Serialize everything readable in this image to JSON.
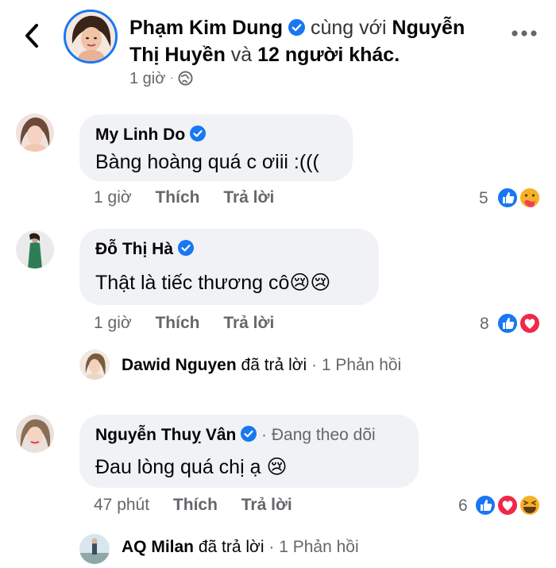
{
  "header": {
    "author": "Phạm Kim Dung",
    "with_prefix": "cùng với",
    "tagged_1_line1": "Nguyễn",
    "tagged_1_line2": "Thị Huyền",
    "and_word": "và",
    "others": "12 người khác.",
    "time": "1 giờ",
    "privacy_icon": "globe-icon",
    "verified_color": "#1877f2"
  },
  "comments": [
    {
      "name": "My Linh Do",
      "text": "Bàng hoàng quá c ơiii :(((",
      "time": "1 giờ",
      "like_label": "Thích",
      "reply_label": "Trả lời",
      "reaction_count": "5",
      "reactions": [
        "like-reaction-icon",
        "care-reaction-icon"
      ]
    },
    {
      "name": "Đỗ Thị Hà",
      "text": "Thật là tiếc thương cô",
      "emoji": "😢😢",
      "time": "1 giờ",
      "like_label": "Thích",
      "reply_label": "Trả lời",
      "reaction_count": "8",
      "reactions": [
        "like-reaction-icon",
        "love-reaction-icon"
      ],
      "reply_summary": {
        "name": "Dawid Nguyen",
        "action": "đã trả lời",
        "count": "1 Phản hồi"
      }
    },
    {
      "name": "Nguyễn Thuỵ Vân",
      "follow": "Đang theo dõi",
      "text": "Đau lòng quá chị ạ",
      "emoji": "😢",
      "time": "47 phút",
      "like_label": "Thích",
      "reply_label": "Trả lời",
      "reaction_count": "6",
      "reactions": [
        "like-reaction-icon",
        "love-reaction-icon",
        "haha-reaction-icon"
      ],
      "reply_summary": {
        "name": "AQ Milan",
        "action": "đã trả lời",
        "count": "1 Phản hồi"
      }
    }
  ],
  "colors": {
    "like": "#1877f2",
    "love": "#f02849",
    "care": "#f7b125",
    "bubble": "#f0f2f5",
    "muted": "#65676b"
  }
}
